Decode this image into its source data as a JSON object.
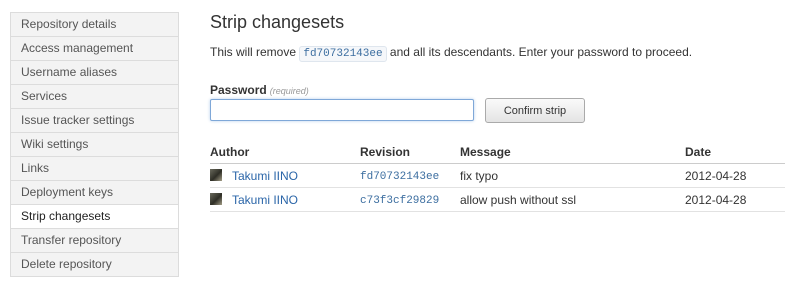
{
  "sidebar": {
    "items": [
      {
        "label": "Repository details"
      },
      {
        "label": "Access management"
      },
      {
        "label": "Username aliases"
      },
      {
        "label": "Services"
      },
      {
        "label": "Issue tracker settings"
      },
      {
        "label": "Wiki settings"
      },
      {
        "label": "Links"
      },
      {
        "label": "Deployment keys"
      },
      {
        "label": "Strip changesets",
        "active": true
      },
      {
        "label": "Transfer repository"
      },
      {
        "label": "Delete repository"
      }
    ]
  },
  "main": {
    "title": "Strip changesets",
    "description": {
      "before": "This will remove ",
      "changeset": "fd70732143ee",
      "after": " and all its descendants. Enter your password to proceed."
    },
    "password": {
      "label": "Password",
      "required_note": "(required)",
      "value": "",
      "placeholder": ""
    },
    "confirm_button": "Confirm strip"
  },
  "table": {
    "headers": {
      "author": "Author",
      "revision": "Revision",
      "message": "Message",
      "date": "Date"
    },
    "rows": [
      {
        "author": "Takumi IINO",
        "revision": "fd70732143ee",
        "message": "fix typo",
        "date": "2012-04-28"
      },
      {
        "author": "Takumi IINO",
        "revision": "c73f3cf29829",
        "message": "allow push without ssl",
        "date": "2012-04-28"
      }
    ]
  },
  "colors": {
    "link": "#2a65a8",
    "sidebar_bg": "#f3f3f3",
    "input_focus": "#7fa8d8"
  }
}
